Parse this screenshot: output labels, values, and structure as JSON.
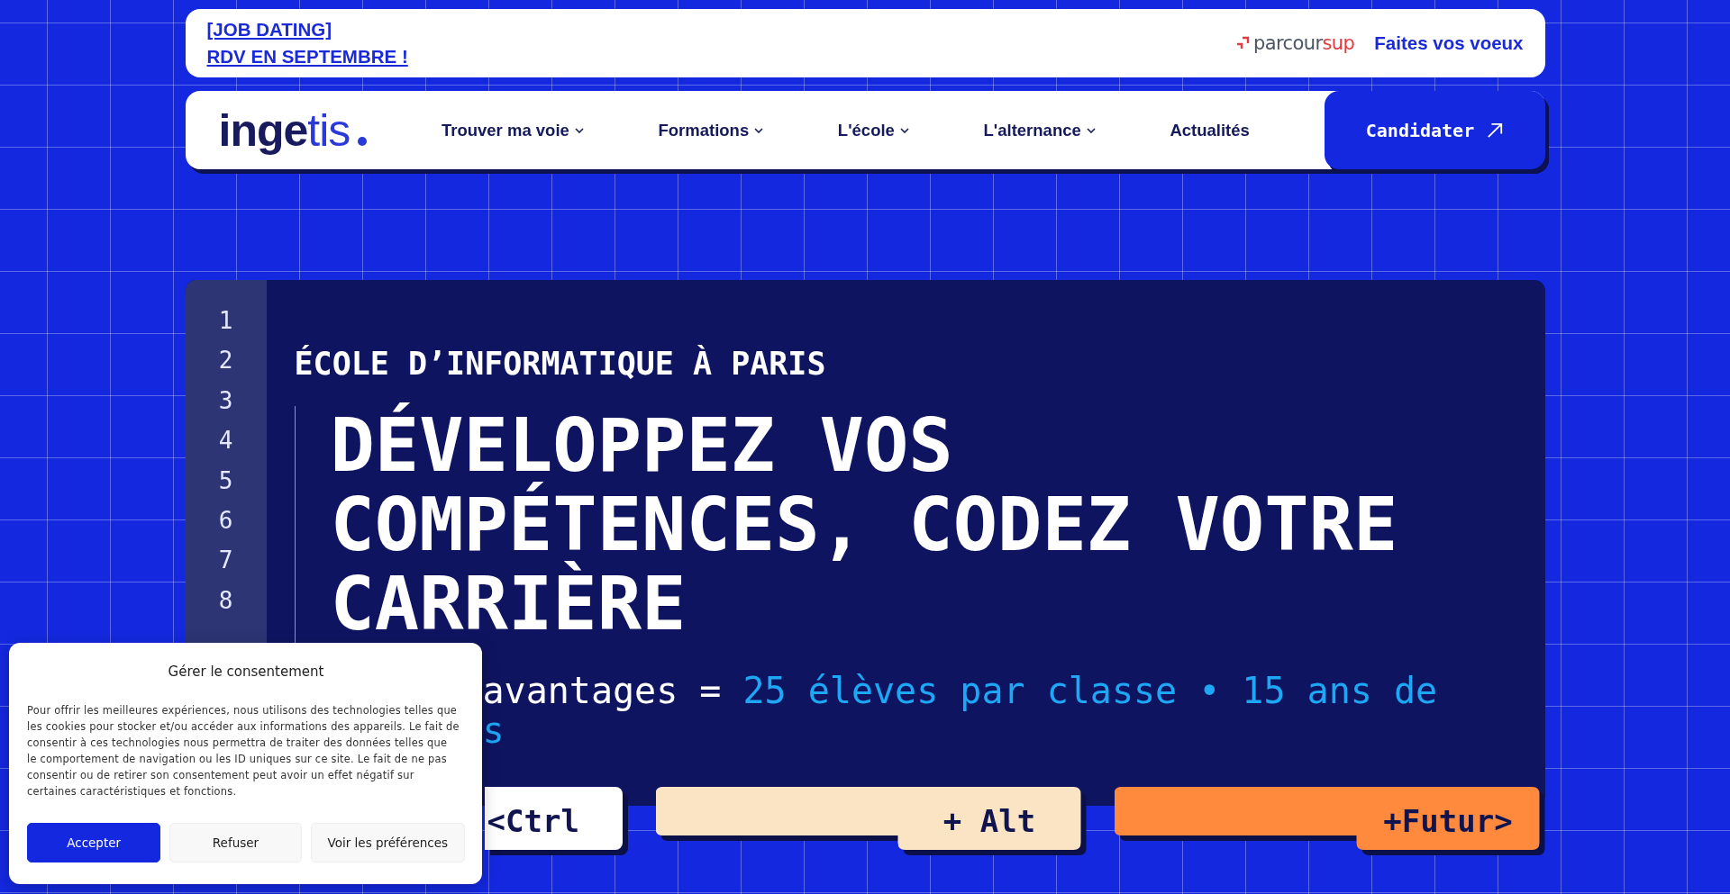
{
  "banner": {
    "announcement_lines": [
      "[JOB DATING]",
      "RDV EN SEPTEMBRE !"
    ],
    "partner_logo": {
      "text": "parcour",
      "accent_text": "sup"
    },
    "partner_link": "Faites vos voeux"
  },
  "navbar": {
    "logo": {
      "bold_text": "inge",
      "light_text": "tis"
    },
    "items": [
      {
        "label": "Trouver ma voie",
        "has_menu": true
      },
      {
        "label": "Formations",
        "has_menu": true
      },
      {
        "label": "L'école",
        "has_menu": true
      },
      {
        "label": "L'alternance",
        "has_menu": true
      },
      {
        "label": "Actualités",
        "has_menu": false
      }
    ],
    "cta": "Candidater"
  },
  "hero": {
    "line_numbers": [
      "1",
      "2",
      "3",
      "4",
      "5",
      "6",
      "7",
      "8"
    ],
    "eyebrow": "ÉCOLE D’INFORMATIQUE À PARIS",
    "title": "DÉVELOPPEZ VOS COMPÉTENCES, CODEZ VOTRE CARRIÈRE",
    "code_line": {
      "variable": "avantages",
      "operator": "=",
      "value": "25 élèves par classe • 15 ans de",
      "value_end": "s"
    },
    "keys": [
      {
        "label": "<Ctrl",
        "kind": "plain",
        "color": "#ffffff"
      },
      {
        "label": "+ Alt",
        "kind": "enter",
        "color": "#fbe4c4"
      },
      {
        "label": "+Futur>",
        "kind": "enter",
        "color": "#ff8a3d"
      }
    ]
  },
  "consent_dialog": {
    "title": "Gérer le consentement",
    "text": "Pour offrir les meilleures expériences, nous utilisons des technologies telles que les cookies pour stocker et/ou accéder aux informations des appareils. Le fait de consentir à ces technologies nous permettra de traiter des données telles que le comportement de navigation ou les ID uniques sur ce site. Le fait de ne pas consentir ou de retirer son consentement peut avoir un effet négatif sur certaines caractéristiques et fonctions.",
    "buttons": [
      {
        "label": "Accepter",
        "kind": "accept"
      },
      {
        "label": "Refuser",
        "kind": "refuse"
      },
      {
        "label": "Voir les préférences",
        "kind": "preferences"
      }
    ]
  }
}
